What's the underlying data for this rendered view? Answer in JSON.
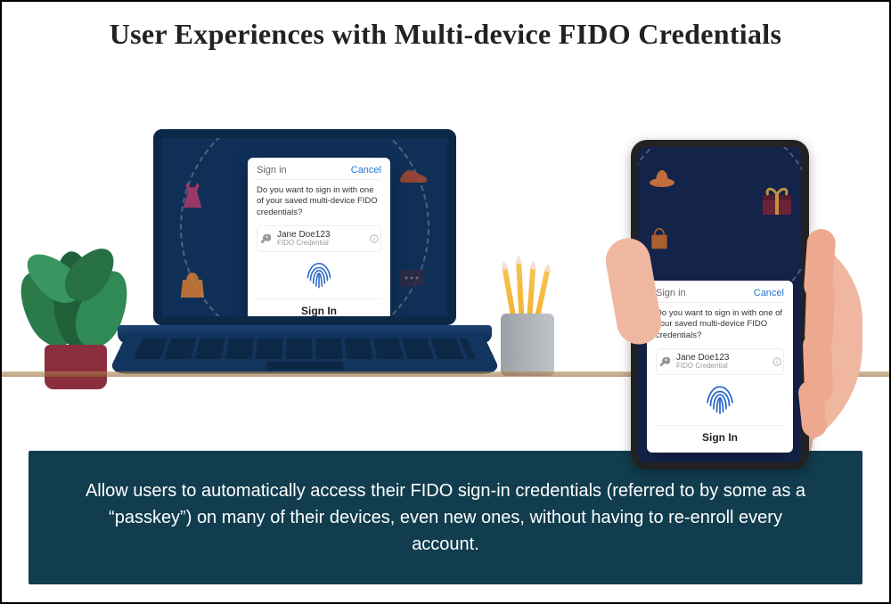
{
  "title": "User Experiences with Multi-device FIDO Credentials",
  "dialog": {
    "header": "Sign in",
    "cancel": "Cancel",
    "prompt": "Do you want to sign in with one of your saved multi-device FIDO credentials?",
    "credential_name": "Jane Doe123",
    "credential_sub": "FIDO Credential",
    "signin_label": "Sign In"
  },
  "banner": "Allow users to automatically access their FIDO sign-in credentials (referred to by some as a “passkey”) on many of their devices, even new ones, without having to re-enroll every account.",
  "colors": {
    "banner_bg": "#113d4f",
    "screen_bg": "#12234c",
    "accent_blue": "#2176d2",
    "skin": "#f0b7a0"
  }
}
